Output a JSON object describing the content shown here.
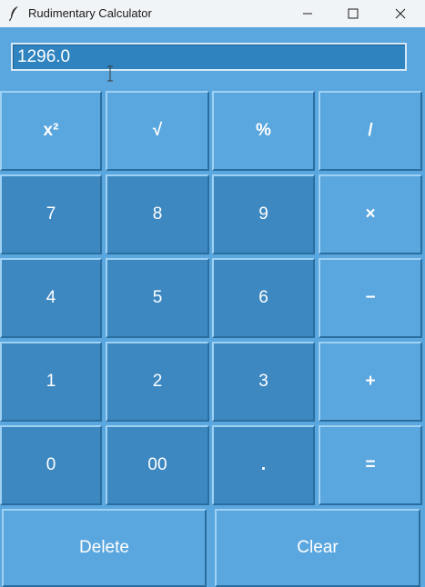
{
  "window": {
    "title": "Rudimentary Calculator",
    "icon": "feather-icon",
    "controls": {
      "minimize_icon": "minimize-icon",
      "maximize_icon": "maximize-icon",
      "close_icon": "close-icon"
    }
  },
  "display": {
    "value": "1296.0"
  },
  "keys": {
    "square": {
      "label": "x²"
    },
    "sqrt": {
      "label": "√"
    },
    "percent": {
      "label": "%"
    },
    "divide": {
      "label": "/"
    },
    "seven": {
      "label": "7"
    },
    "eight": {
      "label": "8"
    },
    "nine": {
      "label": "9"
    },
    "multiply": {
      "label": "×"
    },
    "four": {
      "label": "4"
    },
    "five": {
      "label": "5"
    },
    "six": {
      "label": "6"
    },
    "subtract": {
      "label": "−"
    },
    "one": {
      "label": "1"
    },
    "two": {
      "label": "2"
    },
    "three": {
      "label": "3"
    },
    "add": {
      "label": "+"
    },
    "zero": {
      "label": "0"
    },
    "double_zero": {
      "label": "00"
    },
    "decimal": {
      "label": "."
    },
    "equals": {
      "label": "="
    },
    "delete": {
      "label": "Delete"
    },
    "clear": {
      "label": "Clear"
    }
  },
  "colors": {
    "window_bg": "#5aa6de",
    "digit_key_bg": "#3d88c1",
    "function_key_bg": "#5aa6de",
    "display_bg": "#2f83bf",
    "text": "#ffffff"
  }
}
